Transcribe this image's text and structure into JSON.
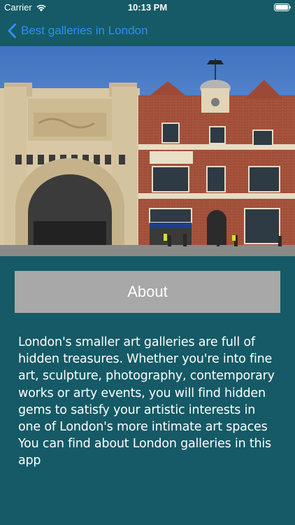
{
  "status_bar": {
    "carrier": "Carrier",
    "time": "10:13 PM",
    "icons": [
      "wifi-icon",
      "battery-icon"
    ]
  },
  "nav": {
    "back_label": "Best galleries in London",
    "back_icon": "chevron-left-icon"
  },
  "hero": {
    "image": "gallery-building-photo"
  },
  "about_button": {
    "label": "About"
  },
  "description": {
    "text": "London's smaller art galleries are full of hidden treasures. Whether you're into fine art, sculpture, photography, contemporary works or arty events, you will find hidden gems to satisfy your artistic interests in one of London's more intimate art spaces You can find about London galleries in this app"
  },
  "colors": {
    "background": "#155a66",
    "accent": "#2f8ff5",
    "button": "#a8a8a8",
    "text": "#ffffff"
  }
}
